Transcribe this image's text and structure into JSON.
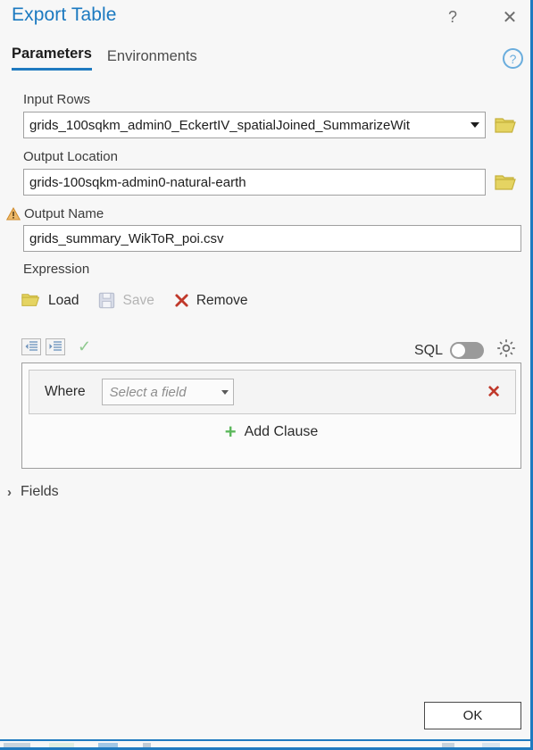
{
  "window": {
    "title": "Export Table",
    "help_glyph": "?",
    "close_glyph": "✕"
  },
  "tabs": [
    {
      "label": "Parameters",
      "active": true
    },
    {
      "label": "Environments",
      "active": false
    }
  ],
  "help_button": {
    "glyph": "?"
  },
  "fields": {
    "input_rows": {
      "label": "Input Rows",
      "value": "grids_100sqkm_admin0_EckertIV_spatialJoined_SummarizeWit",
      "browse_icon": "folder-icon"
    },
    "output_location": {
      "label": "Output Location",
      "value": "grids-100sqkm-admin0-natural-earth",
      "browse_icon": "folder-icon"
    },
    "output_name": {
      "label": "Output Name",
      "value": "grids_summary_WikToR_poi.csv",
      "warning_icon": "warning-triangle-icon"
    }
  },
  "expression": {
    "label": "Expression",
    "load_label": "Load",
    "save_label": "Save",
    "save_disabled": true,
    "remove_label": "Remove",
    "sql_label": "SQL",
    "sql_enabled": false
  },
  "clause": {
    "where_label": "Where",
    "field_placeholder": "Select a field",
    "delete_glyph": "✕",
    "add_clause_label": "Add Clause",
    "add_plus": "+"
  },
  "fields_section": {
    "label": "Fields",
    "chevron": "›",
    "expanded": false
  },
  "footer": {
    "ok_label": "OK"
  },
  "colors": {
    "accent": "#1f7ac0",
    "title": "#1b79c0",
    "folder": "#dcc84b",
    "warning": "#e8a33d",
    "remove_x": "#c0392b",
    "add_plus": "#5cb85c",
    "check": "#8fc98f",
    "background": "#f7f7f7"
  }
}
